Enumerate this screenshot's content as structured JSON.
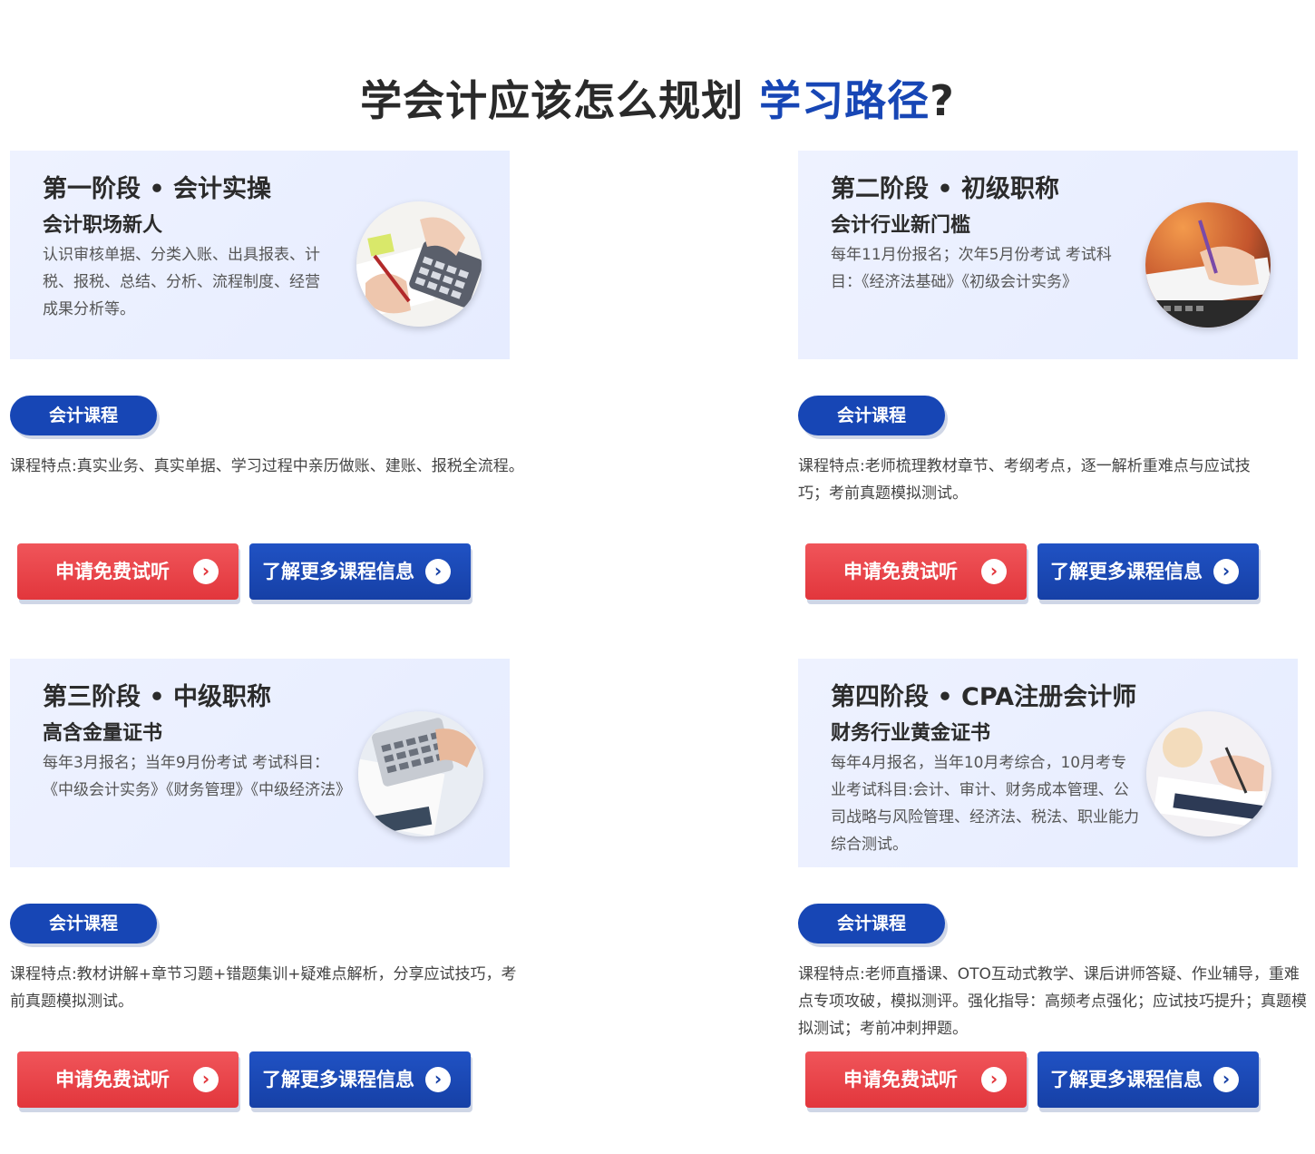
{
  "title": {
    "main": "学会计应该怎么规划",
    "highlight": "学习路径",
    "suffix": "?"
  },
  "stages": [
    {
      "title": "第一阶段 • 会计实操",
      "subtitle": "会计职场新人",
      "description": "认识审核单据、分类入账、出具报表、计税、报税、总结、分析、流程制度、经营成果分析等。",
      "tag": "会计课程",
      "features": "课程特点:真实业务、真实单据、学习过程中亲历做账、建账、报税全流程。",
      "btn_trial": "申请免费试听",
      "btn_more": "了解更多课程信息"
    },
    {
      "title": "第二阶段 • 初级职称",
      "subtitle": "会计行业新门槛",
      "description": "每年11月份报名；次年5月份考试 考试科目：《经济法基础》《初级会计实务》",
      "tag": "会计课程",
      "features": "课程特点:老师梳理教材章节、考纲考点，逐一解析重难点与应试技巧；考前真题模拟测试。",
      "btn_trial": "申请免费试听",
      "btn_more": "了解更多课程信息"
    },
    {
      "title": "第三阶段 • 中级职称",
      "subtitle": "高含金量证书",
      "description": "每年3月报名；当年9月份考试 考试科目：《中级会计实务》《财务管理》《中级经济法》",
      "tag": "会计课程",
      "features": "课程特点:教材讲解+章节习题+错题集训+疑难点解析，分享应试技巧，考前真题模拟测试。",
      "btn_trial": "申请免费试听",
      "btn_more": "了解更多课程信息"
    },
    {
      "title": "第四阶段 • CPA注册会计师",
      "subtitle": "财务行业黄金证书",
      "description": "每年4月报名，当年10月考综合，10月考专业考试科目:会计、审计、财务成本管理、公司战略与风险管理、经济法、税法、职业能力综合测试。",
      "tag": "会计课程",
      "features": "课程特点:老师直播课、OTO互动式教学、课后讲师答疑、作业辅导，重难点专项攻破，模拟测评。强化指导：高频考点强化；应试技巧提升；真题模拟测试；考前冲刺押题。",
      "btn_trial": "申请免费试听",
      "btn_more": "了解更多课程信息"
    }
  ],
  "icons": {
    "arrow": "chevron-right-icon"
  },
  "colors": {
    "brand_blue": "#1746b5",
    "red": "#e2363c",
    "panel_bg": "#eef2ff"
  }
}
